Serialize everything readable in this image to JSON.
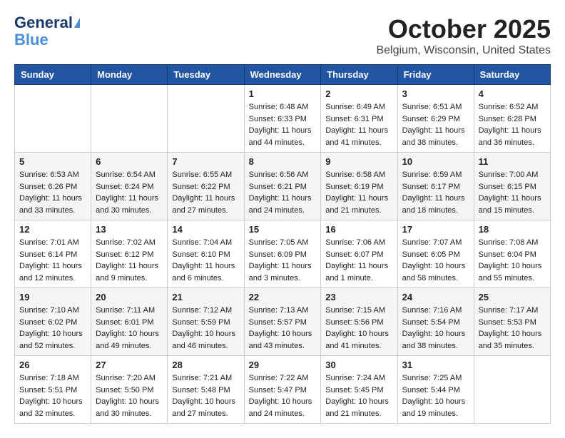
{
  "header": {
    "logo_line1": "General",
    "logo_line2": "Blue",
    "title": "October 2025",
    "subtitle": "Belgium, Wisconsin, United States"
  },
  "weekdays": [
    "Sunday",
    "Monday",
    "Tuesday",
    "Wednesday",
    "Thursday",
    "Friday",
    "Saturday"
  ],
  "weeks": [
    [
      {
        "day": "",
        "info": ""
      },
      {
        "day": "",
        "info": ""
      },
      {
        "day": "",
        "info": ""
      },
      {
        "day": "1",
        "info": "Sunrise: 6:48 AM\nSunset: 6:33 PM\nDaylight: 11 hours\nand 44 minutes."
      },
      {
        "day": "2",
        "info": "Sunrise: 6:49 AM\nSunset: 6:31 PM\nDaylight: 11 hours\nand 41 minutes."
      },
      {
        "day": "3",
        "info": "Sunrise: 6:51 AM\nSunset: 6:29 PM\nDaylight: 11 hours\nand 38 minutes."
      },
      {
        "day": "4",
        "info": "Sunrise: 6:52 AM\nSunset: 6:28 PM\nDaylight: 11 hours\nand 36 minutes."
      }
    ],
    [
      {
        "day": "5",
        "info": "Sunrise: 6:53 AM\nSunset: 6:26 PM\nDaylight: 11 hours\nand 33 minutes."
      },
      {
        "day": "6",
        "info": "Sunrise: 6:54 AM\nSunset: 6:24 PM\nDaylight: 11 hours\nand 30 minutes."
      },
      {
        "day": "7",
        "info": "Sunrise: 6:55 AM\nSunset: 6:22 PM\nDaylight: 11 hours\nand 27 minutes."
      },
      {
        "day": "8",
        "info": "Sunrise: 6:56 AM\nSunset: 6:21 PM\nDaylight: 11 hours\nand 24 minutes."
      },
      {
        "day": "9",
        "info": "Sunrise: 6:58 AM\nSunset: 6:19 PM\nDaylight: 11 hours\nand 21 minutes."
      },
      {
        "day": "10",
        "info": "Sunrise: 6:59 AM\nSunset: 6:17 PM\nDaylight: 11 hours\nand 18 minutes."
      },
      {
        "day": "11",
        "info": "Sunrise: 7:00 AM\nSunset: 6:15 PM\nDaylight: 11 hours\nand 15 minutes."
      }
    ],
    [
      {
        "day": "12",
        "info": "Sunrise: 7:01 AM\nSunset: 6:14 PM\nDaylight: 11 hours\nand 12 minutes."
      },
      {
        "day": "13",
        "info": "Sunrise: 7:02 AM\nSunset: 6:12 PM\nDaylight: 11 hours\nand 9 minutes."
      },
      {
        "day": "14",
        "info": "Sunrise: 7:04 AM\nSunset: 6:10 PM\nDaylight: 11 hours\nand 6 minutes."
      },
      {
        "day": "15",
        "info": "Sunrise: 7:05 AM\nSunset: 6:09 PM\nDaylight: 11 hours\nand 3 minutes."
      },
      {
        "day": "16",
        "info": "Sunrise: 7:06 AM\nSunset: 6:07 PM\nDaylight: 11 hours\nand 1 minute."
      },
      {
        "day": "17",
        "info": "Sunrise: 7:07 AM\nSunset: 6:05 PM\nDaylight: 10 hours\nand 58 minutes."
      },
      {
        "day": "18",
        "info": "Sunrise: 7:08 AM\nSunset: 6:04 PM\nDaylight: 10 hours\nand 55 minutes."
      }
    ],
    [
      {
        "day": "19",
        "info": "Sunrise: 7:10 AM\nSunset: 6:02 PM\nDaylight: 10 hours\nand 52 minutes."
      },
      {
        "day": "20",
        "info": "Sunrise: 7:11 AM\nSunset: 6:01 PM\nDaylight: 10 hours\nand 49 minutes."
      },
      {
        "day": "21",
        "info": "Sunrise: 7:12 AM\nSunset: 5:59 PM\nDaylight: 10 hours\nand 46 minutes."
      },
      {
        "day": "22",
        "info": "Sunrise: 7:13 AM\nSunset: 5:57 PM\nDaylight: 10 hours\nand 43 minutes."
      },
      {
        "day": "23",
        "info": "Sunrise: 7:15 AM\nSunset: 5:56 PM\nDaylight: 10 hours\nand 41 minutes."
      },
      {
        "day": "24",
        "info": "Sunrise: 7:16 AM\nSunset: 5:54 PM\nDaylight: 10 hours\nand 38 minutes."
      },
      {
        "day": "25",
        "info": "Sunrise: 7:17 AM\nSunset: 5:53 PM\nDaylight: 10 hours\nand 35 minutes."
      }
    ],
    [
      {
        "day": "26",
        "info": "Sunrise: 7:18 AM\nSunset: 5:51 PM\nDaylight: 10 hours\nand 32 minutes."
      },
      {
        "day": "27",
        "info": "Sunrise: 7:20 AM\nSunset: 5:50 PM\nDaylight: 10 hours\nand 30 minutes."
      },
      {
        "day": "28",
        "info": "Sunrise: 7:21 AM\nSunset: 5:48 PM\nDaylight: 10 hours\nand 27 minutes."
      },
      {
        "day": "29",
        "info": "Sunrise: 7:22 AM\nSunset: 5:47 PM\nDaylight: 10 hours\nand 24 minutes."
      },
      {
        "day": "30",
        "info": "Sunrise: 7:24 AM\nSunset: 5:45 PM\nDaylight: 10 hours\nand 21 minutes."
      },
      {
        "day": "31",
        "info": "Sunrise: 7:25 AM\nSunset: 5:44 PM\nDaylight: 10 hours\nand 19 minutes."
      },
      {
        "day": "",
        "info": ""
      }
    ]
  ]
}
